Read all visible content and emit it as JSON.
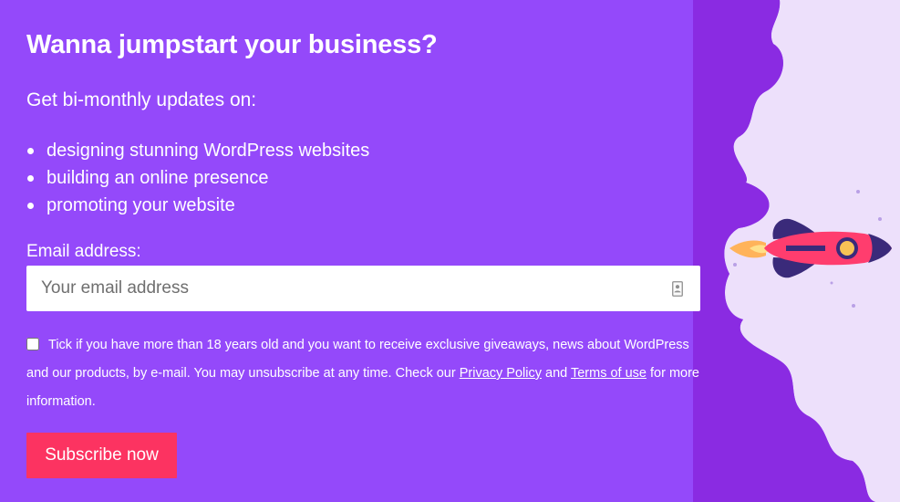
{
  "newsletter": {
    "title": "Wanna jumpstart your business?",
    "subtitle": "Get bi-monthly updates on:",
    "bullets": [
      "designing stunning WordPress websites",
      "building an online presence",
      "promoting your website"
    ],
    "email_label": "Email address:",
    "email_placeholder": "Your email address",
    "email_value": "",
    "consent_checked": false,
    "consent_text_1": "Tick if you have more than 18 years old and you want to receive exclusive giveaways, news about WordPress and our products, by e-mail. You may unsubscribe at any time. Check our ",
    "privacy_link": "Privacy Policy",
    "consent_and": " and ",
    "terms_link": "Terms of use",
    "consent_text_2": " for more information.",
    "subscribe_label": "Subscribe now"
  },
  "icons": {
    "contact": "contact-card-icon",
    "rocket": "rocket-icon"
  },
  "colors": {
    "background": "#9449fa",
    "cloud_dark": "#8a2be2",
    "sky_light": "#ede0fb",
    "button": "#fc3361",
    "rocket_body": "#ff3d6e",
    "rocket_dark": "#3a2a7a",
    "rocket_window": "#f7c255"
  }
}
